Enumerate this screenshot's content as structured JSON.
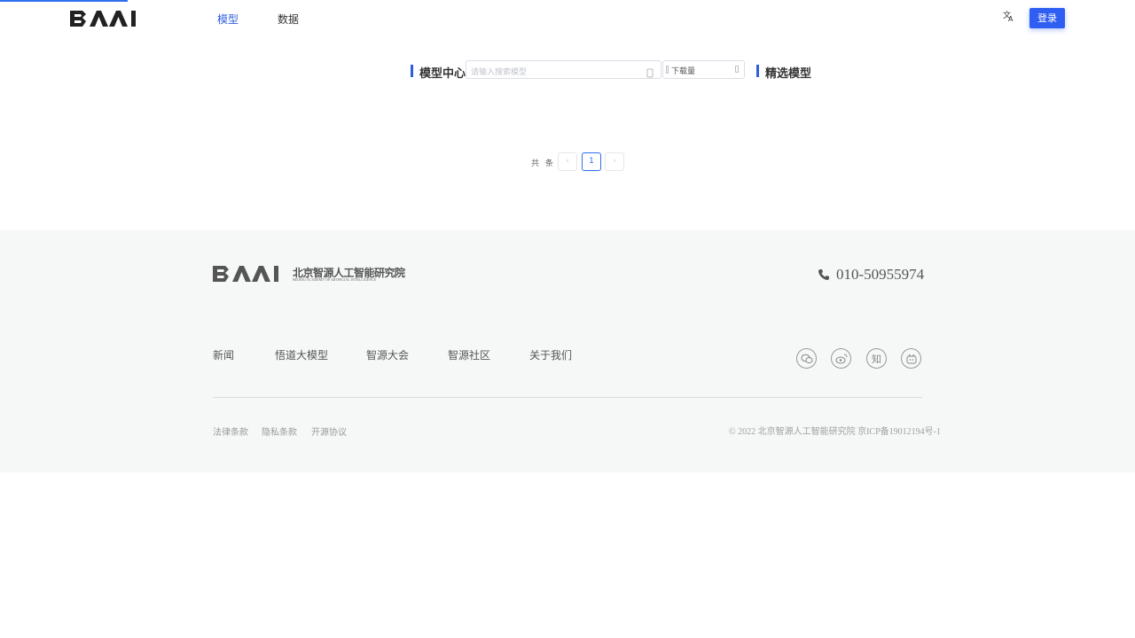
{
  "header": {
    "logo_text": "BAAI",
    "nav": [
      {
        "label": "模型",
        "active": true
      },
      {
        "label": "数据",
        "active": false
      }
    ],
    "language_icon": "translate-icon",
    "login_label": "登录"
  },
  "toolbar": {
    "model_center_title": "模型中心",
    "search_placeholder": "请输入搜索模型",
    "search_icon": "search-icon",
    "sort_selected": "下载量",
    "featured_title": "精选模型"
  },
  "pagination": {
    "total_label": "共 条",
    "current_page": "1",
    "prev_icon": "chevron-left-icon",
    "next_icon": "chevron-right-icon"
  },
  "footer": {
    "logo_text": "BAAI",
    "org_name_cn": "北京智源人工智能研究院",
    "org_name_en": "BEIJING ACADEMY OF ARTIFICIAL INTELLIGENCE",
    "phone": "010-50955974",
    "links": [
      "新闻",
      "悟道大模型",
      "智源大会",
      "智源社区",
      "关于我们"
    ],
    "social": [
      "wechat-icon",
      "weibo-icon",
      "zhihu-icon",
      "bilibili-icon"
    ],
    "zhihu_glyph": "知",
    "bottom_links": [
      "法律条款",
      "隐私条款",
      "开源协议"
    ],
    "copyright": "© 2022 北京智源人工智能研究院 京ICP备19012194号-1"
  },
  "colors": {
    "accent": "#2f5de0",
    "button": "#2f5ef2",
    "footer_bg": "#f6f7f7"
  }
}
